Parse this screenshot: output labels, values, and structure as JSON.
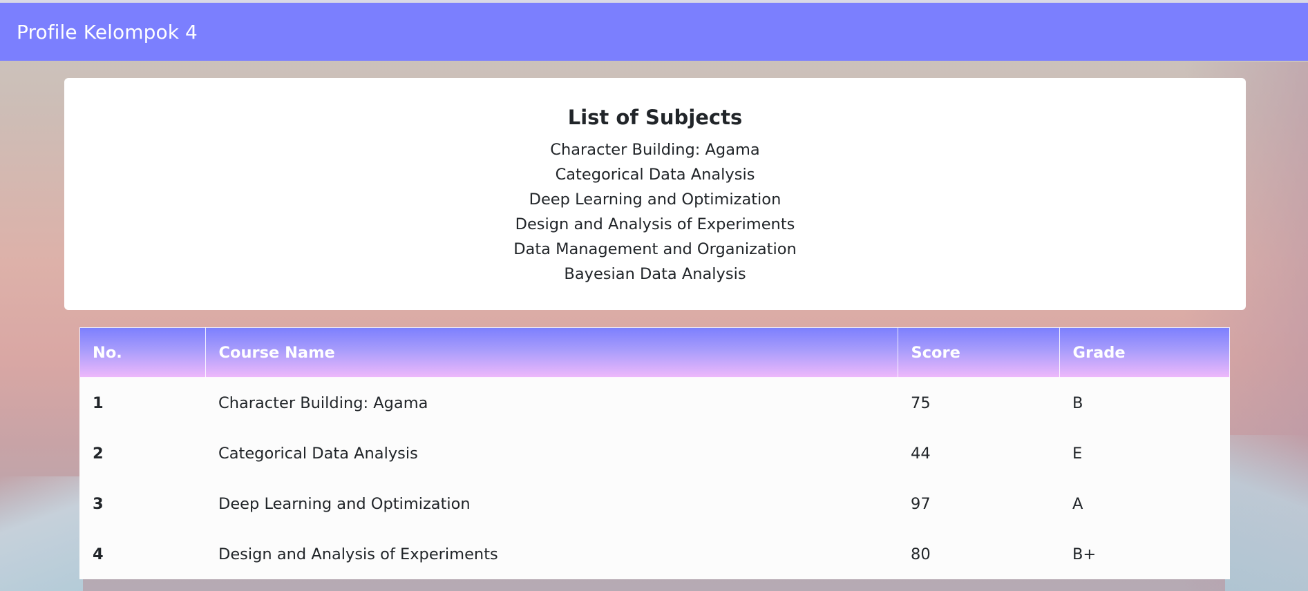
{
  "navbar": {
    "brand": "Profile Kelompok 4"
  },
  "subjects": {
    "title": "List of Subjects",
    "items": [
      "Character Building: Agama",
      "Categorical Data Analysis",
      "Deep Learning and Optimization",
      "Design and Analysis of Experiments",
      "Data Management and Organization",
      "Bayesian Data Analysis"
    ]
  },
  "grades_table": {
    "headers": {
      "no": "No.",
      "course": "Course Name",
      "score": "Score",
      "grade": "Grade"
    },
    "rows": [
      {
        "no": "1",
        "course": "Character Building: Agama",
        "score": "75",
        "grade": "B"
      },
      {
        "no": "2",
        "course": "Categorical Data Analysis",
        "score": "44",
        "grade": "E"
      },
      {
        "no": "3",
        "course": "Deep Learning and Optimization",
        "score": "97",
        "grade": "A"
      },
      {
        "no": "4",
        "course": "Design and Analysis of Experiments",
        "score": "80",
        "grade": "B+"
      }
    ]
  },
  "colors": {
    "navbar": "#7b7ffe",
    "header_gradient_start": "#7b7ffe",
    "header_gradient_end": "#efb9fb"
  }
}
